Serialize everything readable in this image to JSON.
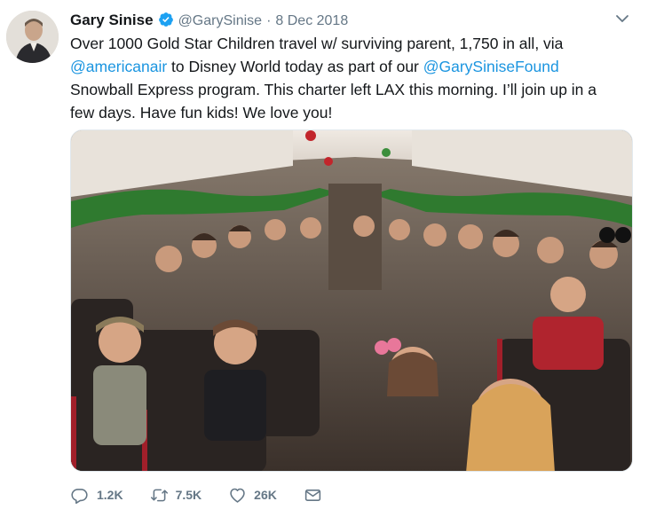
{
  "tweet": {
    "author_name": "Gary Sinise",
    "handle": "@GarySinise",
    "separator": "·",
    "date": "8 Dec 2018",
    "text_segments": {
      "l1": "Over 1000 Gold Star Children travel w/ surviving parent, 1,750 in all, via",
      "l2_mention1": "@americanair",
      "l2_mid": " to Disney World today as part of our ",
      "l2_mention2": "@GarySiniseFound",
      "l3": "Snowball Express program. This charter left LAX this morning. I’ll join up in a",
      "l4": "few days. Have fun kids! We love you!"
    }
  },
  "actions": {
    "reply_count": "1.2K",
    "retweet_count": "7.5K",
    "like_count": "26K"
  },
  "icons": {
    "verified": "verified-badge-icon",
    "caret": "chevron-down-icon",
    "reply": "reply-icon",
    "retweet": "retweet-icon",
    "like": "heart-icon",
    "dm": "envelope-icon"
  },
  "colors": {
    "link": "#1b95e0",
    "muted": "#657786",
    "verified": "#1da1f2"
  }
}
